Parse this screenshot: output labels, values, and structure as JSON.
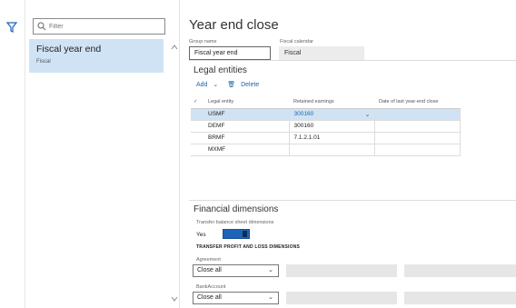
{
  "filter": {
    "placeholder": "Filter"
  },
  "list": {
    "items": [
      {
        "title": "Fiscal year end",
        "subtitle": "Fiscal"
      }
    ]
  },
  "page": {
    "title": "Year end close",
    "group_name_label": "Group name",
    "group_name_value": "Fiscal year end",
    "fiscal_calendar_label": "Fiscal calendar",
    "fiscal_calendar_value": "Fiscal"
  },
  "legal": {
    "title": "Legal entities",
    "add_label": "Add",
    "delete_label": "Delete",
    "columns": [
      "Legal entity",
      "Retained earnings",
      "Date of last year-end close"
    ],
    "rows": [
      {
        "entity": "USMF",
        "retained": "300160",
        "date": ""
      },
      {
        "entity": "DEMF",
        "retained": "300160",
        "date": ""
      },
      {
        "entity": "BRMF",
        "retained": "7.1.2.1.01",
        "date": ""
      },
      {
        "entity": "MXMF",
        "retained": "",
        "date": ""
      }
    ]
  },
  "financial": {
    "title": "Financial dimensions",
    "transfer_label": "Transfer balance sheet dimensions",
    "transfer_value": "Yes",
    "transfer_on": true,
    "pl_heading": "TRANSFER PROFIT AND LOSS DIMENSIONS",
    "agreement_label": "Agreement",
    "agreement_value": "Close all",
    "bank_label": "BankAccount",
    "bank_value": "Close all"
  },
  "colors": {
    "accent": "#1f63b8",
    "selected": "#cfe3f5",
    "link": "#2266aa"
  }
}
